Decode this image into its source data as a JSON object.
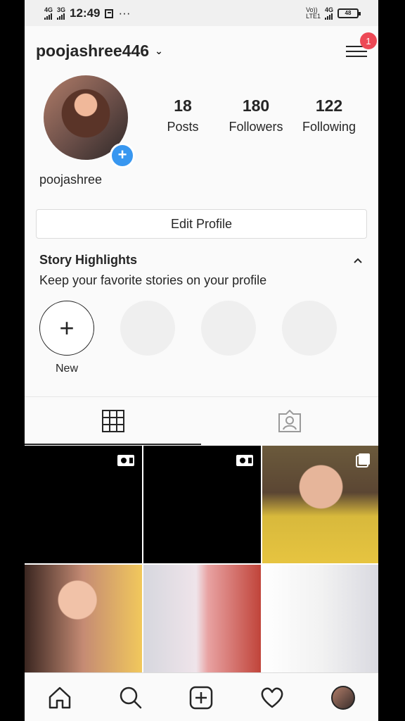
{
  "status": {
    "net1": "4G",
    "net2": "3G",
    "time": "12:49",
    "dots": "···",
    "volte": "Vo))\nLTE1",
    "net3": "4G",
    "battery": "48"
  },
  "header": {
    "username": "poojashree446",
    "notification_count": "1"
  },
  "profile": {
    "display_name": "poojashree",
    "stats": [
      {
        "value": "18",
        "label": "Posts"
      },
      {
        "value": "180",
        "label": "Followers"
      },
      {
        "value": "122",
        "label": "Following"
      }
    ],
    "edit_label": "Edit Profile"
  },
  "highlights": {
    "title": "Story Highlights",
    "subtitle": "Keep your favorite stories on your profile",
    "new_label": "New"
  },
  "colors": {
    "badge": "#ed4956",
    "add": "#3897f0"
  }
}
